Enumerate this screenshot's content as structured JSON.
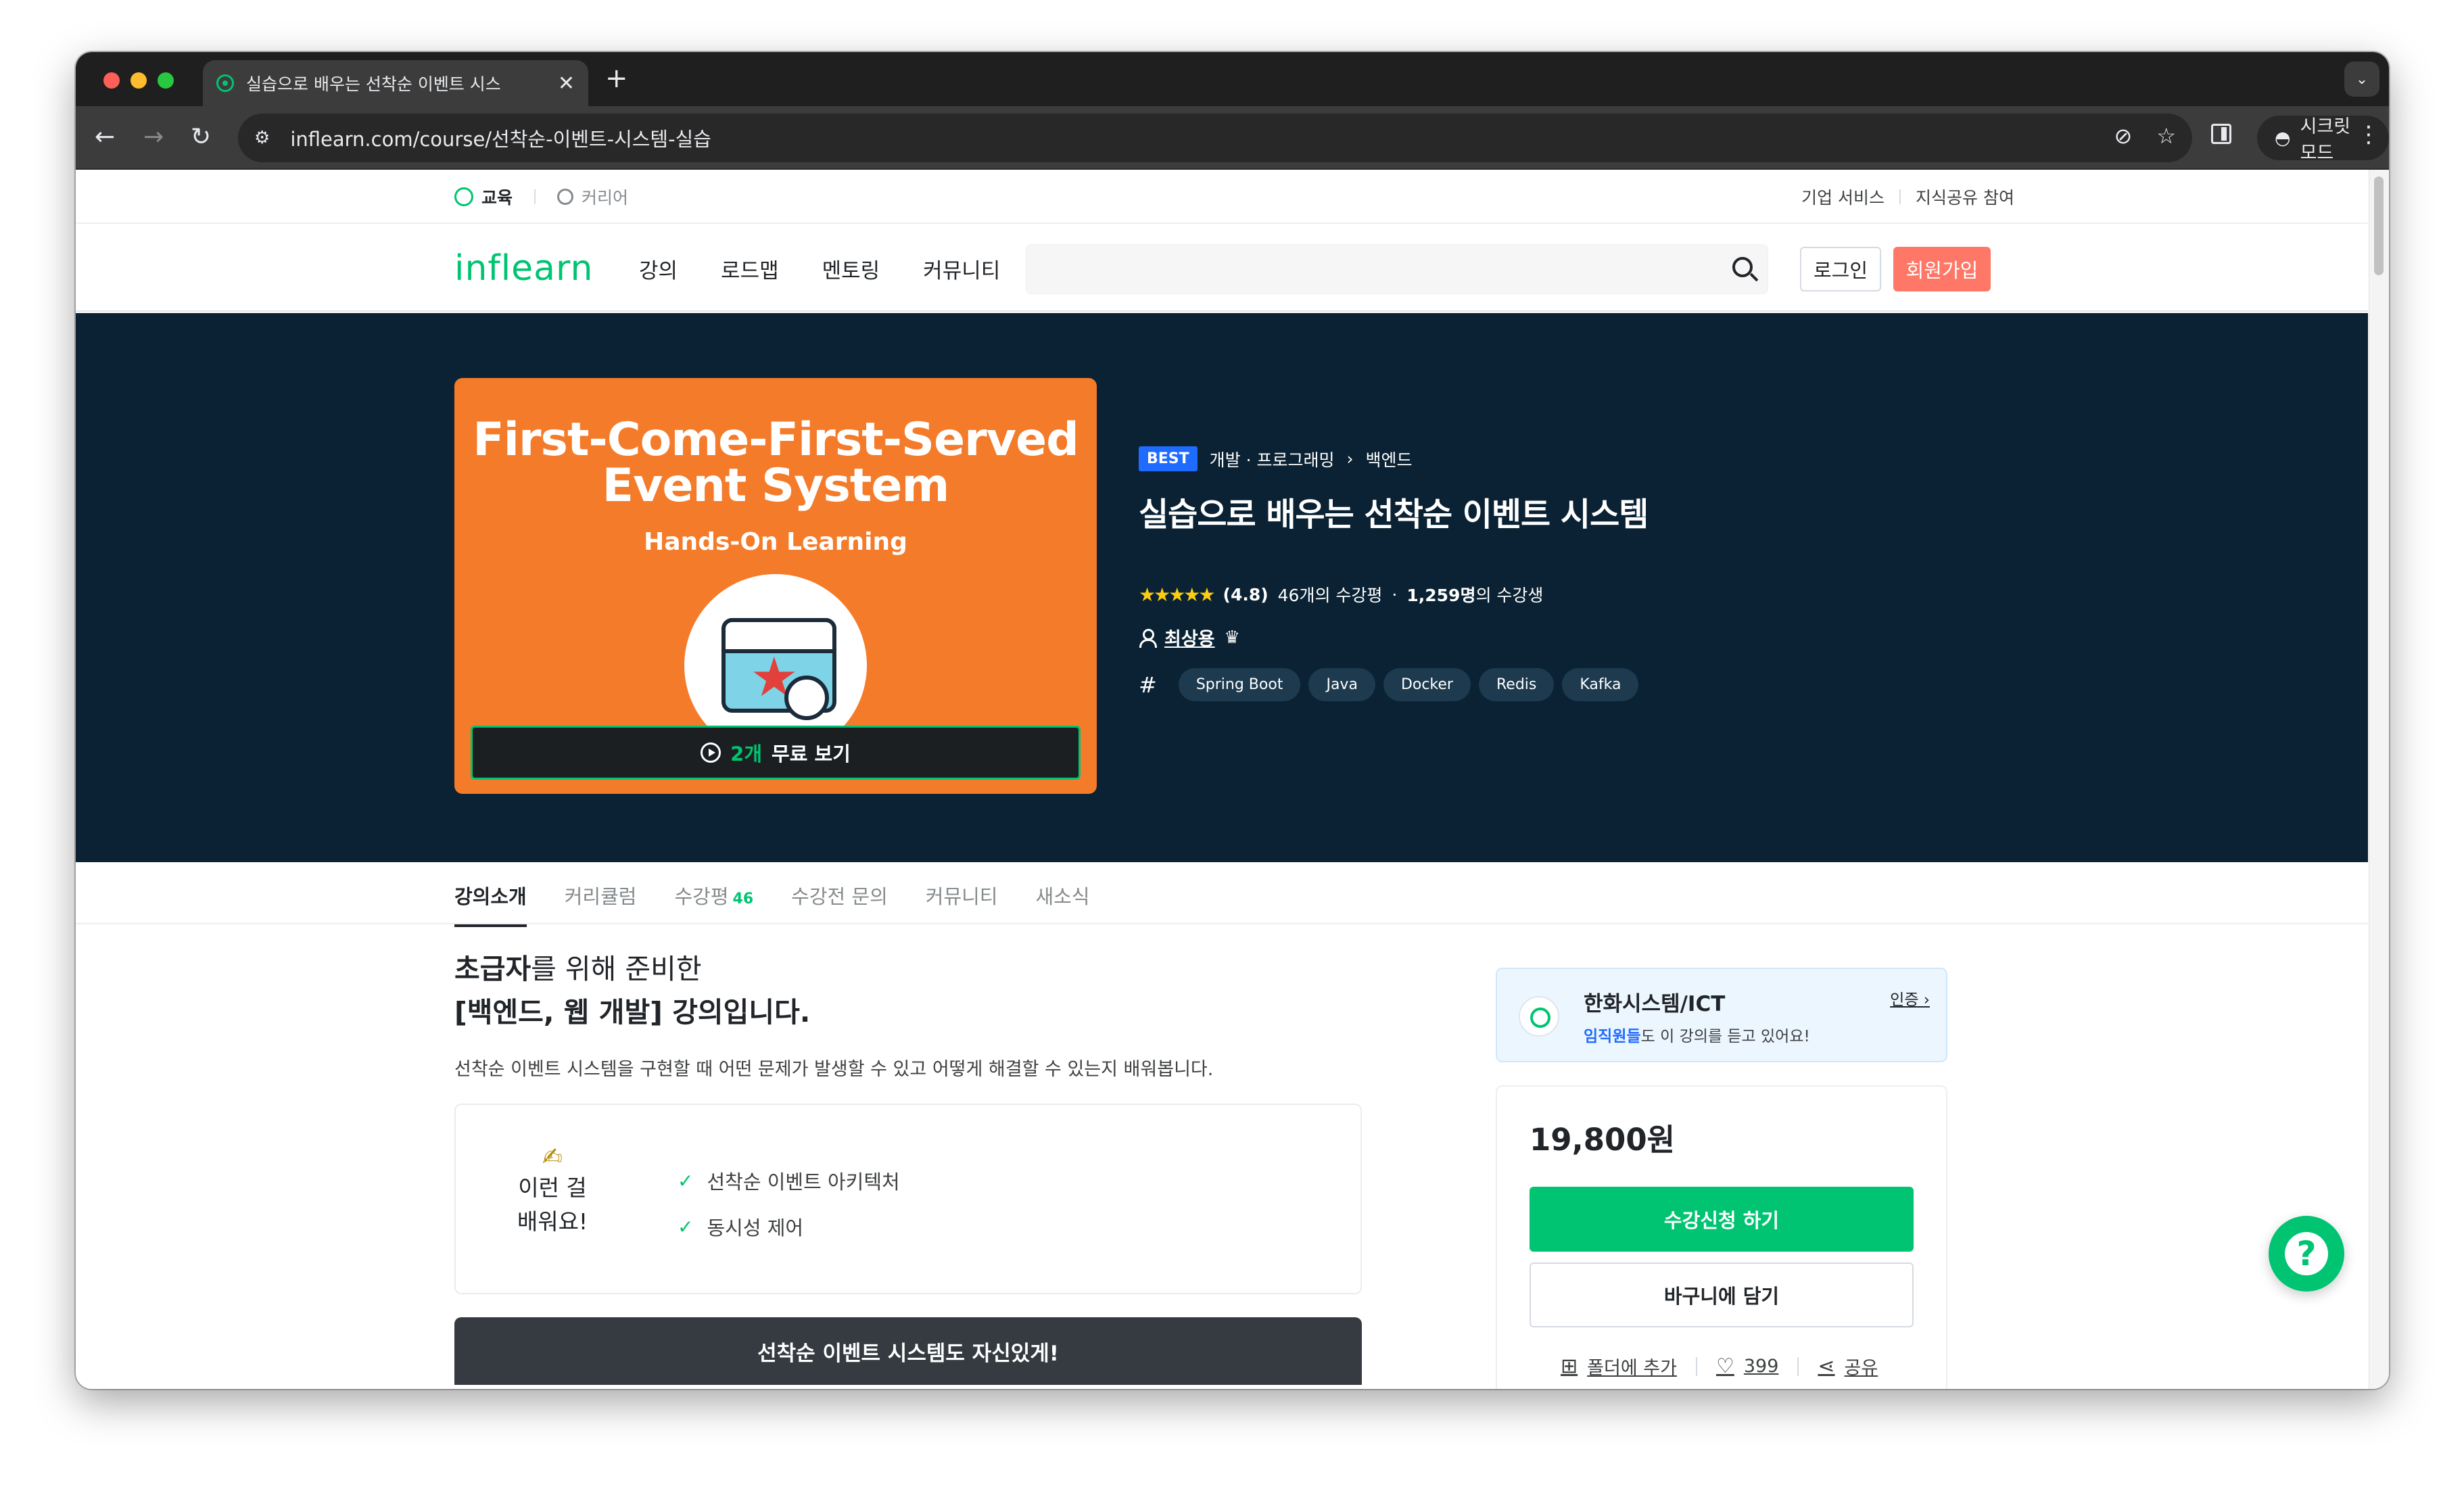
{
  "browser": {
    "tab_title": "실습으로 배우는 선착순 이벤트 시스",
    "tab_close": "✕",
    "new_tab": "+",
    "url": "inflearn.com/course/선착순-이벤트-시스템-실습",
    "incognito_label": "시크릿 모드"
  },
  "utility_bar": {
    "education": "교육",
    "career": "커리어",
    "corporate": "기업 서비스",
    "knowledge_share": "지식공유 참여"
  },
  "gnb": {
    "logo": "inflearn",
    "menu": [
      "강의",
      "로드맵",
      "멘토링",
      "커뮤니티"
    ],
    "search_placeholder": "",
    "login": "로그인",
    "signup": "회원가입"
  },
  "hero": {
    "thumbnail_title_line1": "First-Come-First-Served",
    "thumbnail_title_line2": "Event System",
    "thumbnail_subtitle": "Hands-On Learning",
    "preview_count": "2개",
    "preview_label": "무료 보기",
    "badge": "BEST",
    "category": "개발 · 프로그래밍",
    "subcategory": "백엔드",
    "title": "실습으로 배우는 선착순 이벤트 시스템",
    "rating_value": 4.8,
    "rating_text": "(4.8)",
    "review_count": "46개의 수강평",
    "student_count": "1,259명",
    "student_suffix": "의 수강생",
    "instructor": "최상용",
    "tags": [
      "Spring Boot",
      "Java",
      "Docker",
      "Redis",
      "Kafka"
    ]
  },
  "tabs": [
    {
      "label": "강의소개",
      "active": true
    },
    {
      "label": "커리큘럼"
    },
    {
      "label": "수강평",
      "count": "46"
    },
    {
      "label": "수강전 문의"
    },
    {
      "label": "커뮤니티"
    },
    {
      "label": "새소식"
    }
  ],
  "intro": {
    "line1_bold": "초급자",
    "line1_rest": "를 위해 준비한",
    "line2": "[백엔드, 웹 개발] 강의입니다.",
    "description": "선착순 이벤트 시스템을 구현할 때 어떤 문제가 발생할 수 있고 어떻게 해결할 수 있는지 배워봅니다.",
    "learn_label_line1": "이런 걸",
    "learn_label_line2": "배워요!",
    "learn_items": [
      "선착순 이벤트 아키텍처",
      "동시성 제어"
    ],
    "cta_banner": "선착순 이벤트 시스템도 자신있게!"
  },
  "sidebar": {
    "company_name": "한화시스템/ICT",
    "company_desc_em": "임직원들",
    "company_desc_rest": "도 이 강의를 듣고 있어요!",
    "verify_link": "인증",
    "price": "19,800원",
    "enroll": "수강신청 하기",
    "cart": "바구니에 담기",
    "folder": "폴더에 추가",
    "likes": "399",
    "share": "공유"
  },
  "icons": {
    "star": "★",
    "check": "✓",
    "crown": "♛",
    "hash": "#",
    "pen": "✍",
    "help": "?",
    "heart": "♡",
    "share": "⋖",
    "folder": "⊞",
    "back": "←",
    "forward": "→",
    "reload": "↻",
    "kebab": "⋮",
    "chevron": "›"
  },
  "colors": {
    "brand": "#00c471",
    "hero_bg": "#0a2233",
    "thumbnail_bg": "#f47b2a",
    "signup": "#ff7867",
    "best_badge": "#1f6bff"
  }
}
